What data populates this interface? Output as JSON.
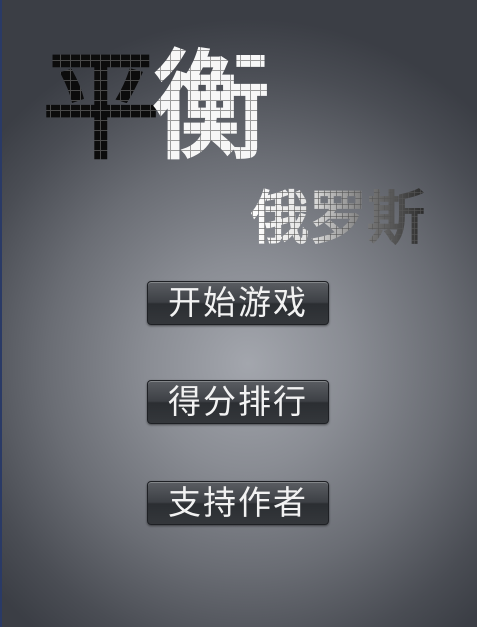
{
  "logo": {
    "title_main": "平衡",
    "title_sub": "俄罗斯"
  },
  "menu": {
    "start_label": "开始游戏",
    "rank_label": "得分排行",
    "support_label": "支持作者"
  },
  "colors": {
    "background_center": "#a3a6ad",
    "background_edge": "#3b3e45",
    "button_fill": "#3d4045",
    "button_text": "#f2f2f2",
    "logo_dark": "#0a0a0a",
    "logo_light": "#f5f5f5"
  }
}
